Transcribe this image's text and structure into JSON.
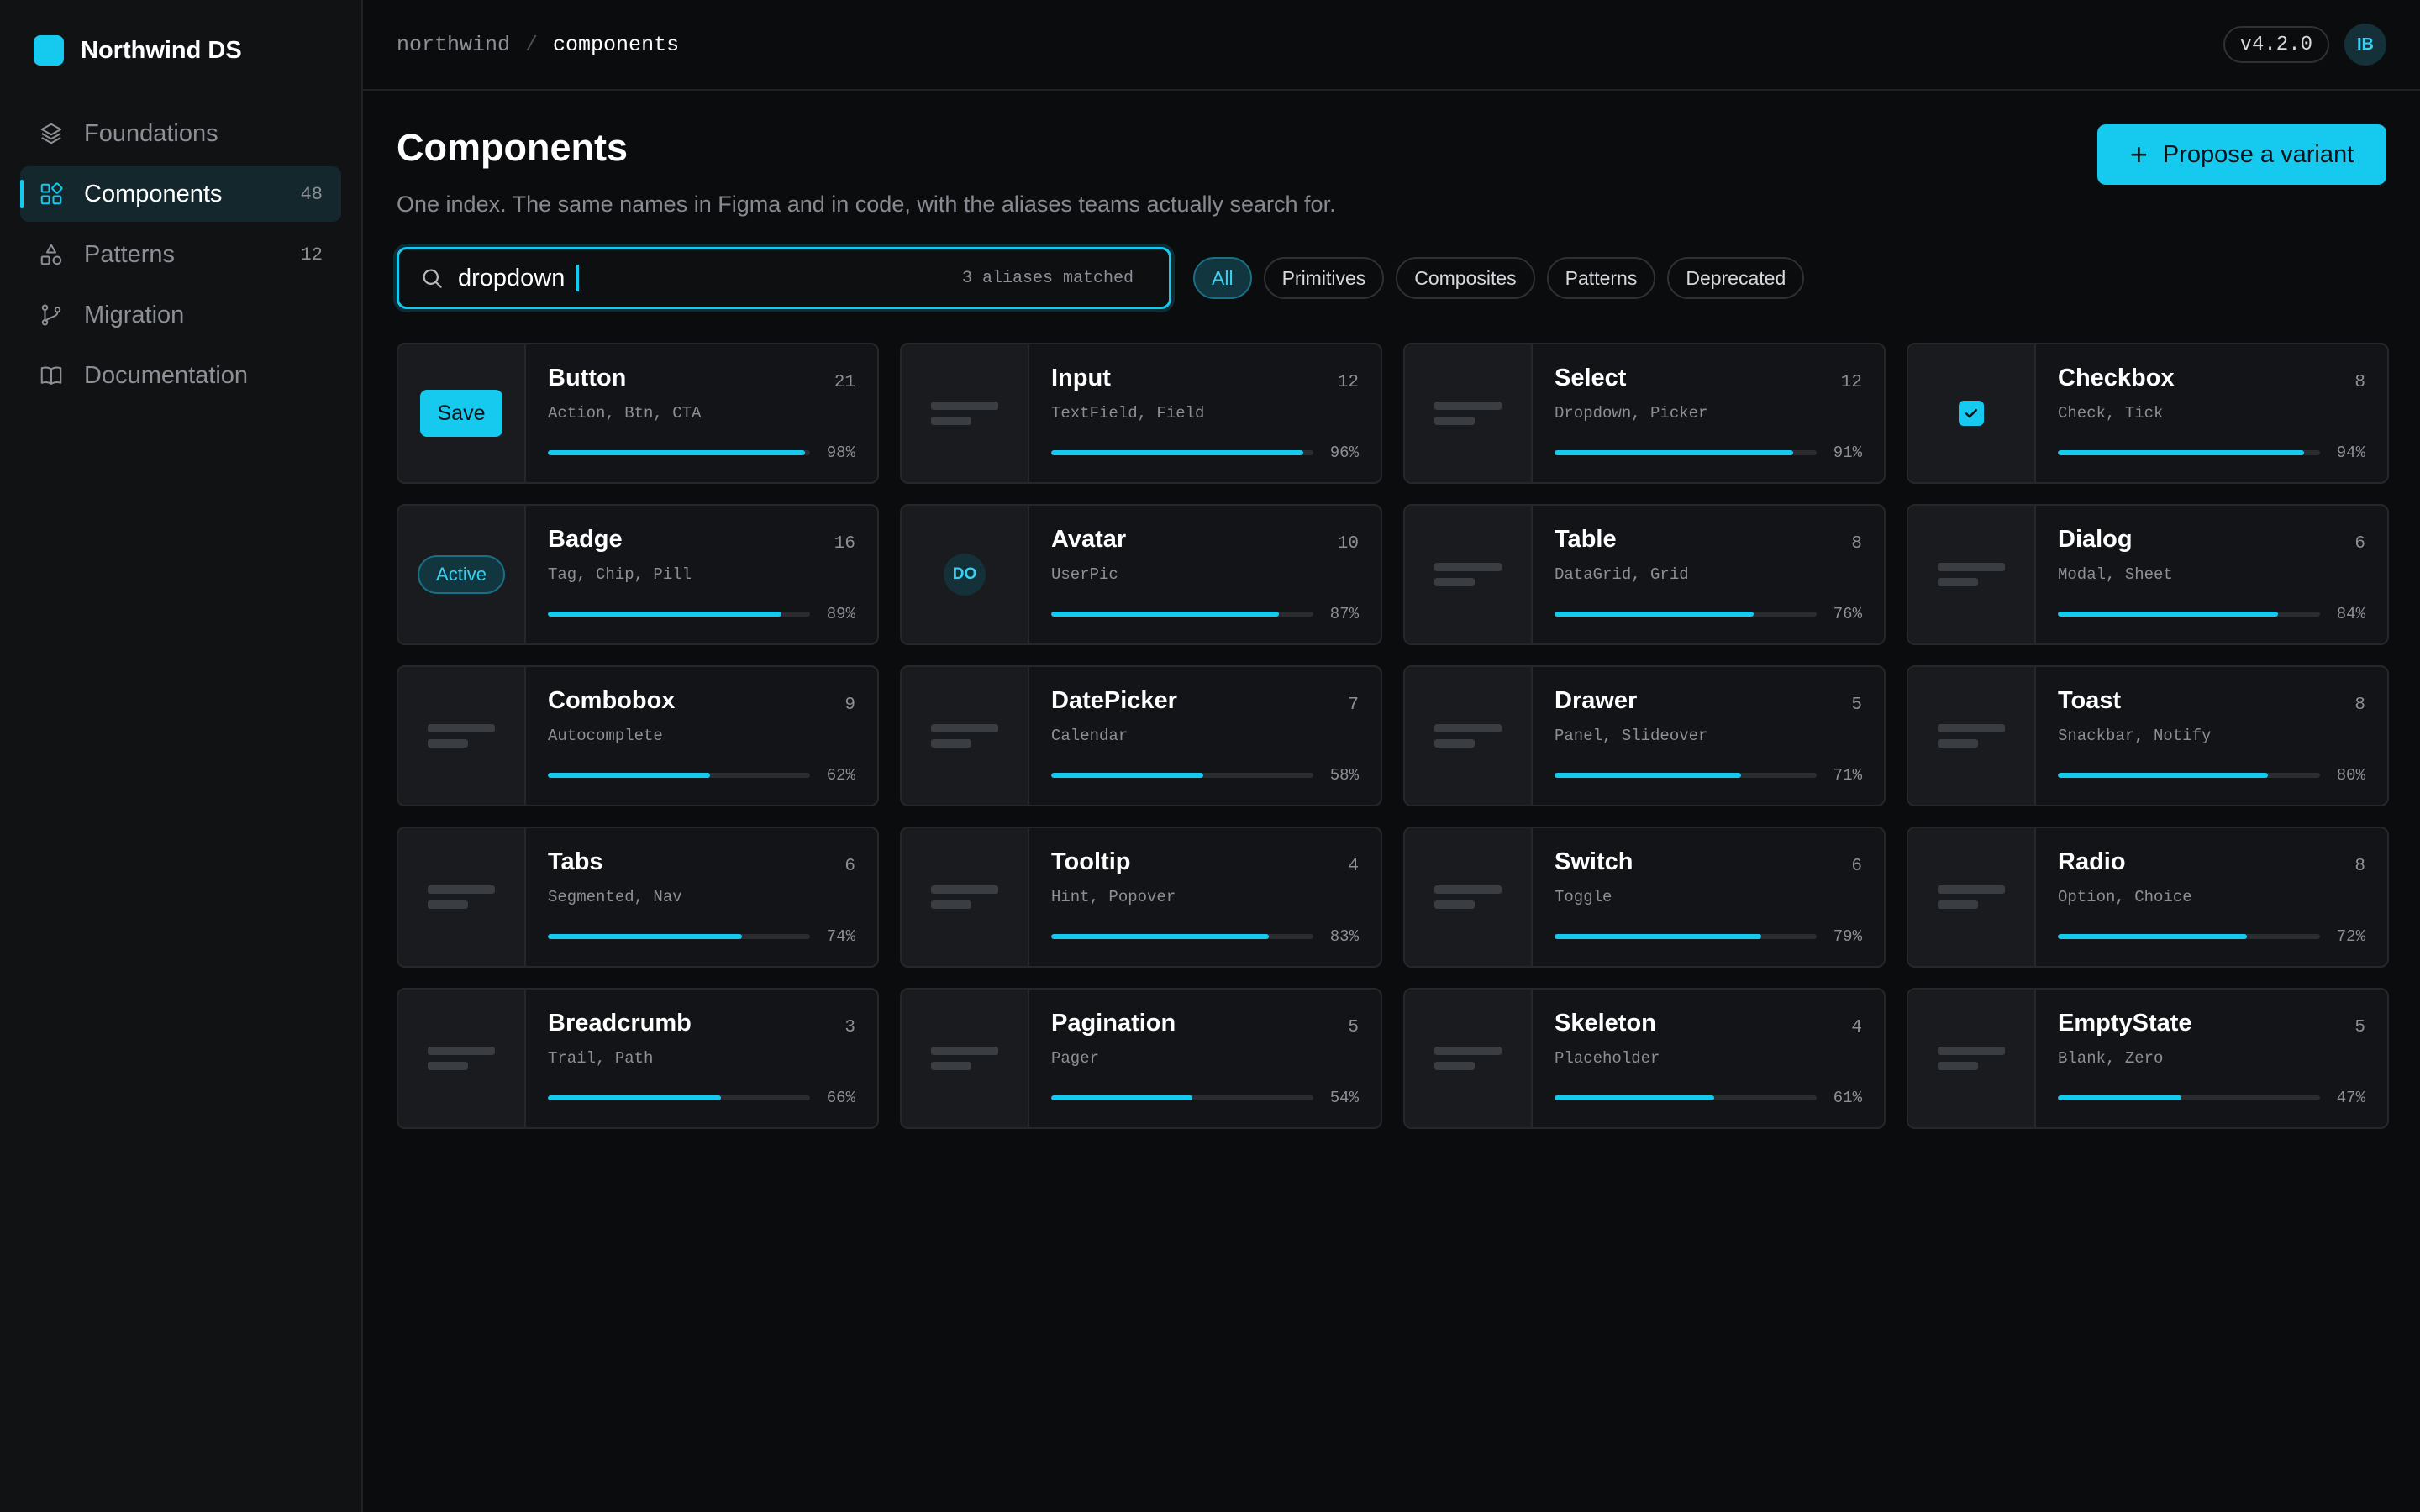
{
  "brand": {
    "name": "Northwind DS",
    "logo_color": "#16c9ee"
  },
  "sidebar": {
    "items": [
      {
        "label": "Foundations",
        "icon": "layers-icon",
        "count": "",
        "active": false
      },
      {
        "label": "Components",
        "icon": "components-icon",
        "count": "48",
        "active": true
      },
      {
        "label": "Patterns",
        "icon": "shapes-icon",
        "count": "12",
        "active": false
      },
      {
        "label": "Migration",
        "icon": "git-branch-icon",
        "count": "",
        "active": false
      },
      {
        "label": "Documentation",
        "icon": "book-icon",
        "count": "",
        "active": false
      }
    ]
  },
  "topbar": {
    "breadcrumb_root": "northwind",
    "breadcrumb_separator": "/",
    "breadcrumb_current": "components",
    "version": "v4.2.0",
    "user_initials": "IB"
  },
  "header": {
    "title": "Components",
    "subtitle": "One index. The same names in Figma and in code, with the aliases teams actually search for.",
    "propose_label": "Propose a variant"
  },
  "search": {
    "value": "dropdown",
    "meta": "3 aliases matched"
  },
  "filters": [
    "All",
    "Primitives",
    "Composites",
    "Patterns",
    "Deprecated"
  ],
  "active_filter": "All",
  "colors": {
    "accent": "#16c9ee",
    "background": "#0b0c0e",
    "sidebar": "#111214",
    "card": "#131417"
  },
  "components": [
    {
      "name": "Button",
      "aliases": "Action, Btn, CTA",
      "count": "21",
      "progress": 98,
      "progress_label": "98%",
      "preview": "button",
      "preview_label": "Save"
    },
    {
      "name": "Input",
      "aliases": "TextField, Field",
      "count": "12",
      "progress": 96,
      "progress_label": "96%",
      "preview": "placeholder"
    },
    {
      "name": "Select",
      "aliases": "Dropdown, Picker",
      "count": "12",
      "progress": 91,
      "progress_label": "91%",
      "preview": "placeholder"
    },
    {
      "name": "Checkbox",
      "aliases": "Check, Tick",
      "count": "8",
      "progress": 94,
      "progress_label": "94%",
      "preview": "checkbox"
    },
    {
      "name": "Badge",
      "aliases": "Tag, Chip, Pill",
      "count": "16",
      "progress": 89,
      "progress_label": "89%",
      "preview": "badge",
      "preview_label": "Active"
    },
    {
      "name": "Avatar",
      "aliases": "UserPic",
      "count": "10",
      "progress": 87,
      "progress_label": "87%",
      "preview": "avatar",
      "preview_label": "DO"
    },
    {
      "name": "Table",
      "aliases": "DataGrid, Grid",
      "count": "8",
      "progress": 76,
      "progress_label": "76%",
      "preview": "placeholder"
    },
    {
      "name": "Dialog",
      "aliases": "Modal, Sheet",
      "count": "6",
      "progress": 84,
      "progress_label": "84%",
      "preview": "placeholder"
    },
    {
      "name": "Combobox",
      "aliases": "Autocomplete",
      "count": "9",
      "progress": 62,
      "progress_label": "62%",
      "preview": "placeholder"
    },
    {
      "name": "DatePicker",
      "aliases": "Calendar",
      "count": "7",
      "progress": 58,
      "progress_label": "58%",
      "preview": "placeholder"
    },
    {
      "name": "Drawer",
      "aliases": "Panel, Slideover",
      "count": "5",
      "progress": 71,
      "progress_label": "71%",
      "preview": "placeholder"
    },
    {
      "name": "Toast",
      "aliases": "Snackbar, Notify",
      "count": "8",
      "progress": 80,
      "progress_label": "80%",
      "preview": "placeholder"
    },
    {
      "name": "Tabs",
      "aliases": "Segmented, Nav",
      "count": "6",
      "progress": 74,
      "progress_label": "74%",
      "preview": "placeholder"
    },
    {
      "name": "Tooltip",
      "aliases": "Hint, Popover",
      "count": "4",
      "progress": 83,
      "progress_label": "83%",
      "preview": "placeholder"
    },
    {
      "name": "Switch",
      "aliases": "Toggle",
      "count": "6",
      "progress": 79,
      "progress_label": "79%",
      "preview": "placeholder"
    },
    {
      "name": "Radio",
      "aliases": "Option, Choice",
      "count": "8",
      "progress": 72,
      "progress_label": "72%",
      "preview": "placeholder"
    },
    {
      "name": "Breadcrumb",
      "aliases": "Trail, Path",
      "count": "3",
      "progress": 66,
      "progress_label": "66%",
      "preview": "placeholder"
    },
    {
      "name": "Pagination",
      "aliases": "Pager",
      "count": "5",
      "progress": 54,
      "progress_label": "54%",
      "preview": "placeholder"
    },
    {
      "name": "Skeleton",
      "aliases": "Placeholder",
      "count": "4",
      "progress": 61,
      "progress_label": "61%",
      "preview": "placeholder"
    },
    {
      "name": "EmptyState",
      "aliases": "Blank, Zero",
      "count": "5",
      "progress": 47,
      "progress_label": "47%",
      "preview": "placeholder"
    }
  ]
}
